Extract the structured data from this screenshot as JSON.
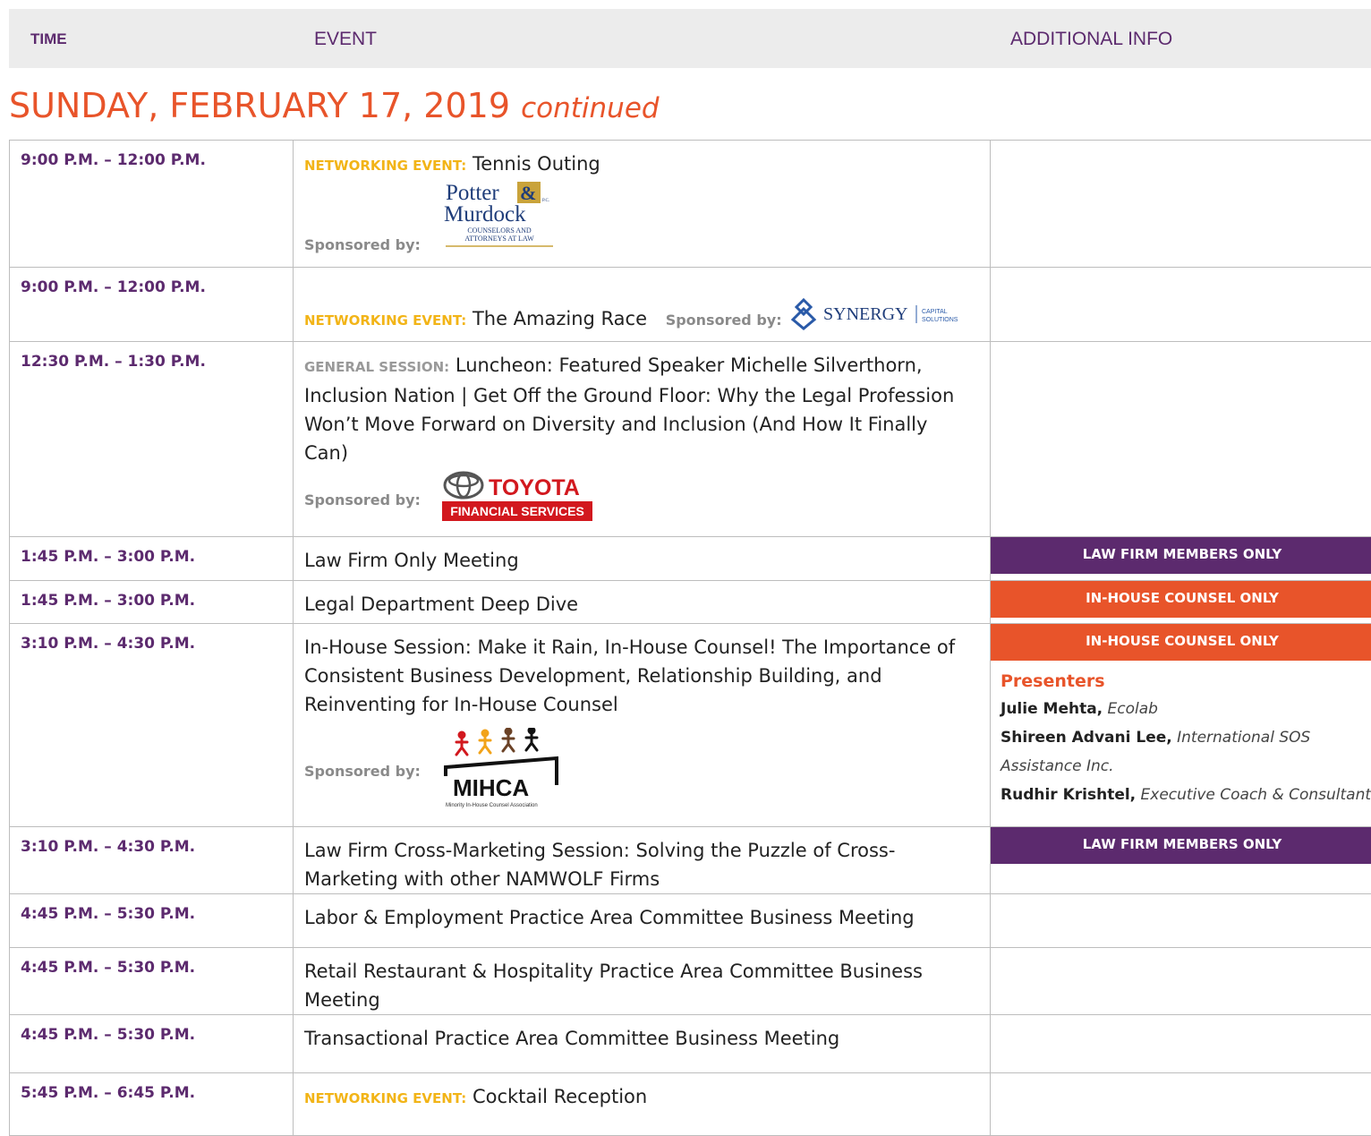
{
  "header": {
    "time": "TIME",
    "event": "EVENT",
    "additional_info": "ADDITIONAL INFO"
  },
  "day": {
    "title": "SUNDAY, FEBRUARY 17, 2019",
    "suffix": "continued"
  },
  "sponsored_by": "Sponsored by:",
  "tags": {
    "networking": "NETWORKING EVENT:",
    "general": "GENERAL SESSION:"
  },
  "rows": [
    {
      "time": "9:00 P.M. – 12:00 P.M.",
      "event": "Tennis Outing"
    },
    {
      "time": "9:00 P.M. – 12:00 P.M.",
      "event": "The Amazing Race"
    },
    {
      "time": "12:30 P.M. – 1:30 P.M.",
      "event": "Luncheon: Featured Speaker Michelle Silverthorn, Inclusion Nation | Get Off the Ground Floor: Why the Legal Profession Won’t Move Forward on Diversity and Inclusion (And How It Finally Can)"
    },
    {
      "time": "1:45 P.M. – 3:00 P.M.",
      "event": "Law Firm Only Meeting",
      "badge": "LAW FIRM MEMBERS ONLY"
    },
    {
      "time": "1:45 P.M. – 3:00 P.M.",
      "event": "Legal Department Deep Dive",
      "badge": "IN-HOUSE COUNSEL ONLY"
    },
    {
      "time": "3:10 P.M. – 4:30 P.M.",
      "event": "In-House Session: Make it Rain, In-House Counsel! The Importance of Consistent Business Development, Relationship Building, and Reinventing for In-House Counsel",
      "badge": "IN-HOUSE COUNSEL ONLY"
    },
    {
      "time": "3:10 P.M. – 4:30 P.M.",
      "event": "Law Firm Cross-Marketing Session: Solving the Puzzle of Cross-Marketing with other NAMWOLF Firms",
      "badge": "LAW FIRM MEMBERS ONLY"
    },
    {
      "time": "4:45 P.M. – 5:30 P.M.",
      "event": "Labor & Employment Practice Area Committee Business Meeting"
    },
    {
      "time": "4:45 P.M. – 5:30 P.M.",
      "event": "Retail Restaurant & Hospitality Practice Area Committee Business Meeting"
    },
    {
      "time": "4:45 P.M. – 5:30 P.M.",
      "event": "Transactional Practice Area Committee Business Meeting"
    },
    {
      "time": "5:45 P.M. – 6:45 P.M.",
      "event": "Cocktail Reception"
    }
  ],
  "presenters": {
    "title": "Presenters",
    "people": [
      {
        "name": "Julie Mehta,",
        "org": "Ecolab"
      },
      {
        "name": "Shireen Advani Lee,",
        "org": "International SOS"
      },
      {
        "name": "",
        "org": "Assistance Inc."
      },
      {
        "name": "Rudhir Krishtel,",
        "org": "Executive Coach & Consultant"
      }
    ]
  },
  "logos": {
    "potter": {
      "line1": "Potter",
      "line2": "Murdock",
      "sub1": "COUNSELORS AND",
      "sub2": "ATTORNEYS AT LAW",
      "pc": "P.C."
    },
    "synergy": {
      "name": "SYNERGY",
      "sub1": "CAPITAL",
      "sub2": "SOLUTIONS"
    },
    "toyota": {
      "name": "TOYOTA",
      "sub": "FINANCIAL SERVICES"
    },
    "mihca": {
      "name": "MIHCA",
      "sub": "Minority In-House Counsel Association"
    }
  },
  "colors": {
    "purple": "#5c2a6e",
    "orange": "#e8542a",
    "gold": "#f2b417",
    "header_bg": "#ececec"
  }
}
